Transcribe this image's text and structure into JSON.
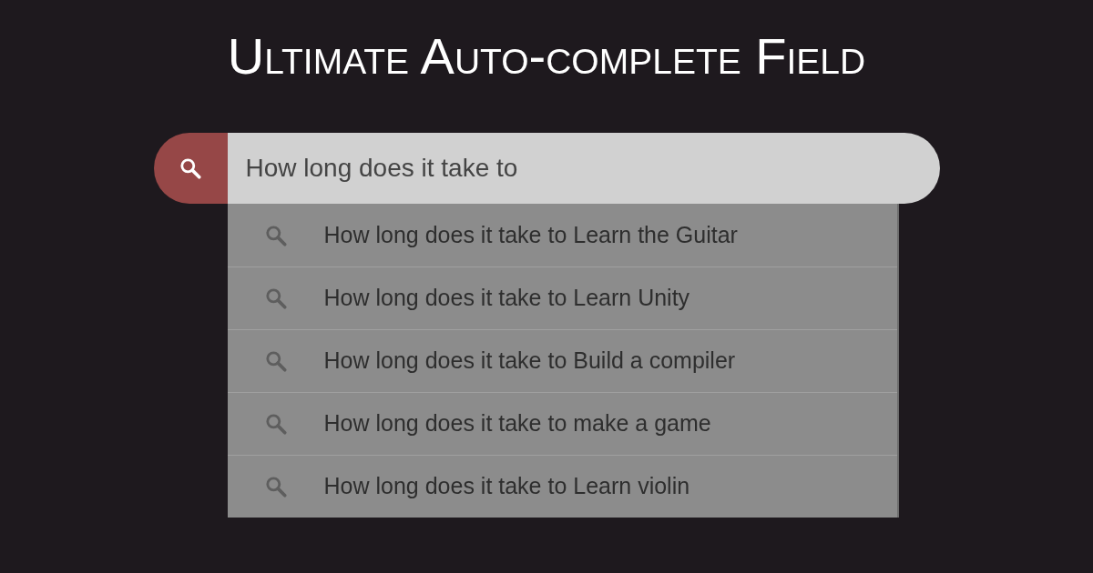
{
  "title": "Ultimate Auto-complete Field",
  "search": {
    "value": "How long does it take to"
  },
  "suggestions": [
    {
      "text": "How long does it take to Learn the Guitar"
    },
    {
      "text": "How long does it take to Learn Unity"
    },
    {
      "text": "How long does it take to Build a compiler"
    },
    {
      "text": "How long does it take to make a game"
    },
    {
      "text": "How long does it take to Learn violin"
    }
  ]
}
